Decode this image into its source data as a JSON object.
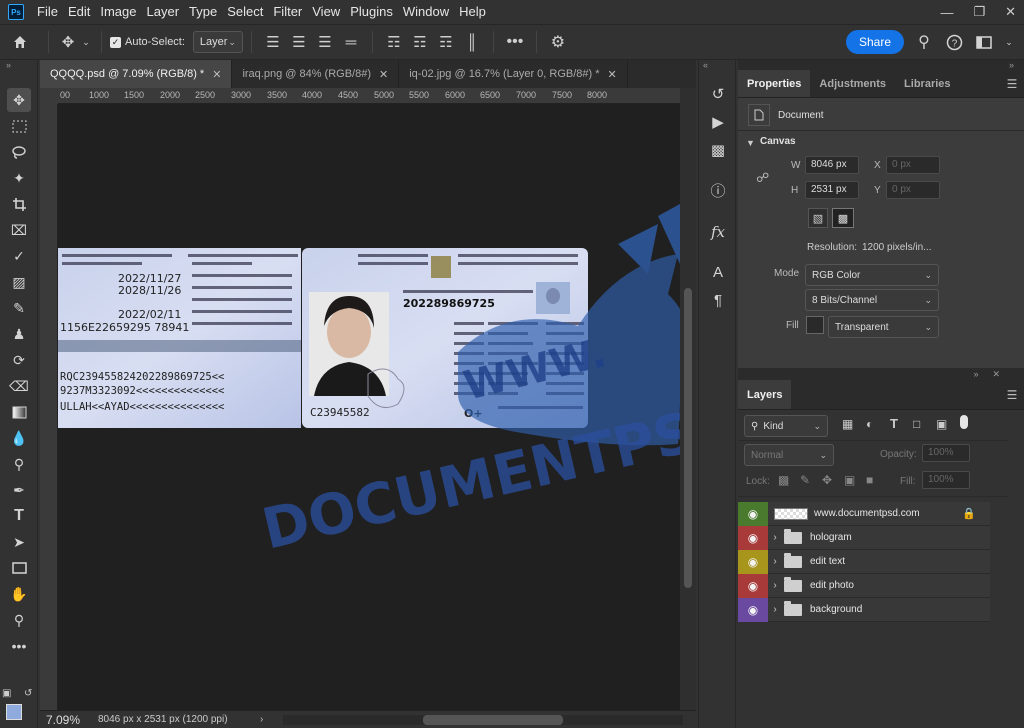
{
  "menubar": {
    "logo": "Ps",
    "items": [
      "File",
      "Edit",
      "Image",
      "Layer",
      "Type",
      "Select",
      "Filter",
      "View",
      "Plugins",
      "Window",
      "Help"
    ]
  },
  "options": {
    "auto_select_label": "Auto-Select:",
    "auto_select_checked": true,
    "target_value": "Layer",
    "share_label": "Share"
  },
  "tabs": [
    {
      "label": "QQQQ.psd @ 7.09% (RGB/8) *",
      "active": true
    },
    {
      "label": "iraq.png @ 84% (RGB/8#)",
      "active": false
    },
    {
      "label": "iq-02.jpg @ 16.7% (Layer 0, RGB/8#) *",
      "active": false
    }
  ],
  "ruler": {
    "ticks": [
      "00",
      "1000",
      "1500",
      "2000",
      "2500",
      "3000",
      "3500",
      "4000",
      "4500",
      "5000",
      "5500",
      "6000",
      "6500",
      "7000",
      "7500",
      "8000"
    ]
  },
  "document": {
    "issue_date": "2022/11/27",
    "expiry_date": "2028/11/26",
    "birth_date": "2022/02/11",
    "family_number": "1156E22659295 78941",
    "card_number": "202289869725",
    "doc_no": "C23945582",
    "blood_type": "O+",
    "mrz": [
      "RQC239455824202289869725<<",
      "9237M3323092<<<<<<<<<<<<<<",
      "ULLAH<<AYAD<<<<<<<<<<<<<<<"
    ],
    "watermark_top": "WWW.",
    "watermark_main": "DOCUMENTPSD.COM"
  },
  "status": {
    "zoom": "7.09%",
    "info": "8046 px x 2531 px (1200 ppi)"
  },
  "properties": {
    "tabs": [
      "Properties",
      "Adjustments",
      "Libraries"
    ],
    "section_type": "Document",
    "canvas_title": "Canvas",
    "width_label": "W",
    "width_value": "8046 px",
    "height_label": "H",
    "height_value": "2531 px",
    "x_label": "X",
    "x_value": "0 px",
    "y_label": "Y",
    "y_value": "0 px",
    "resolution_label": "Resolution:",
    "resolution_value": "1200 pixels/in...",
    "mode_label": "Mode",
    "mode_value": "RGB Color",
    "depth_value": "8 Bits/Channel",
    "fill_label": "Fill",
    "fill_value": "Transparent"
  },
  "layers": {
    "title": "Layers",
    "filter_value": "Kind",
    "blend_mode": "Normal",
    "opacity_label": "Opacity:",
    "opacity_value": "100%",
    "lock_label": "Lock:",
    "fill_label": "Fill:",
    "fill_value": "100%",
    "items": [
      {
        "name": "www.documentpsd.com",
        "color": "#4a7a2e",
        "type": "pixel",
        "locked": true
      },
      {
        "name": "hologram",
        "color": "#a83a3a",
        "type": "group"
      },
      {
        "name": "edit text",
        "color": "#a8951c",
        "type": "group"
      },
      {
        "name": "edit photo",
        "color": "#a83a3a",
        "type": "group"
      },
      {
        "name": "background",
        "color": "#6a4aa0",
        "type": "group"
      }
    ]
  }
}
